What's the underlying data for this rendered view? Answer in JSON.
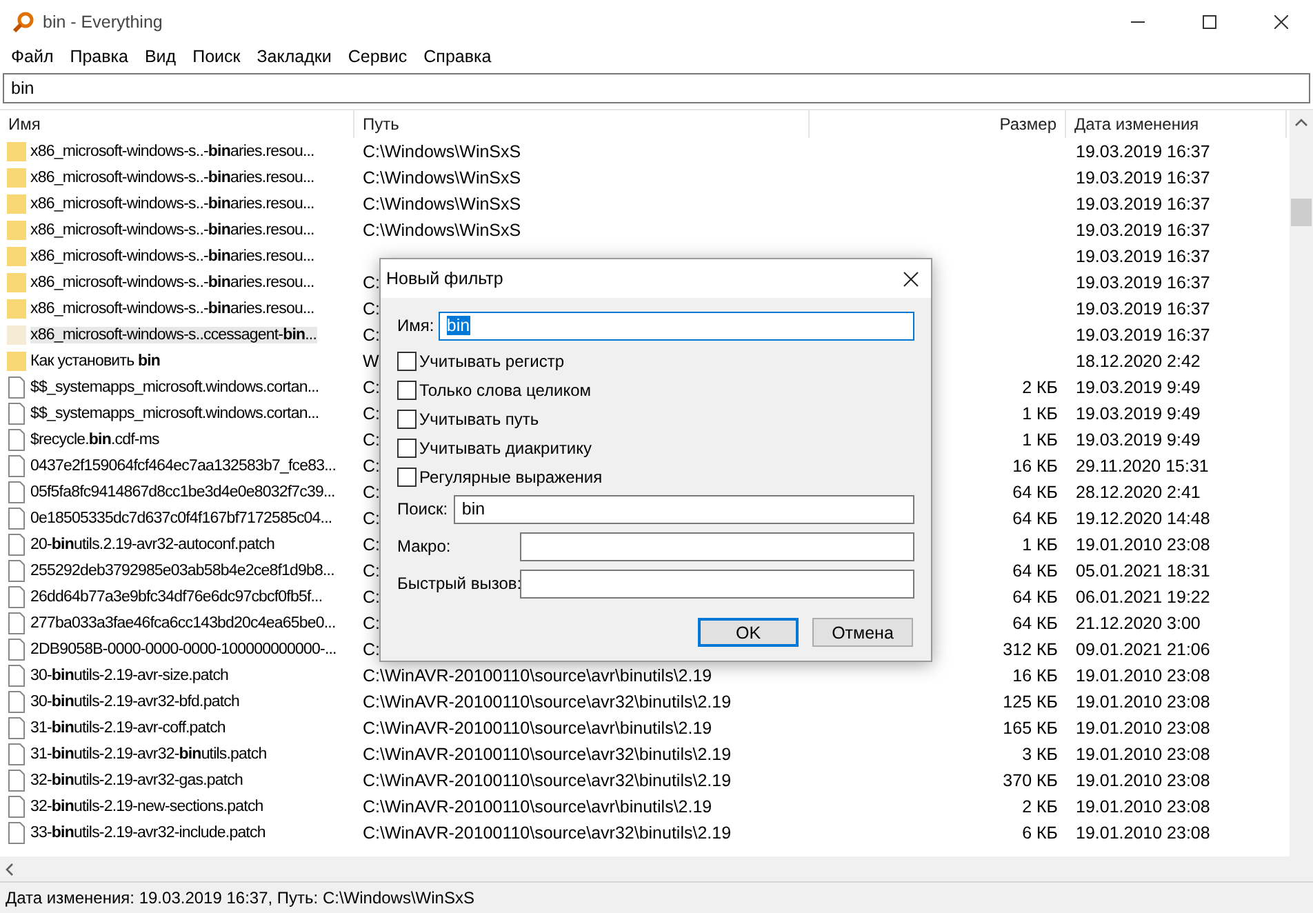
{
  "window": {
    "title": "bin - Everything"
  },
  "menu": [
    {
      "label": "Файл"
    },
    {
      "label": "Правка"
    },
    {
      "label": "Вид"
    },
    {
      "label": "Поиск"
    },
    {
      "label": "Закладки"
    },
    {
      "label": "Сервис"
    },
    {
      "label": "Справка"
    }
  ],
  "search": {
    "value": "bin"
  },
  "table": {
    "columns": [
      "Имя",
      "Путь",
      "Размер",
      "Дата изменения"
    ],
    "rows": [
      {
        "kind": "folder",
        "name": "x86_microsoft-windows-s..-**bin**aries.resou...",
        "path": "C:\\Windows\\WinSxS",
        "date": "19.03.2019 16:37",
        "selected": false
      },
      {
        "kind": "folder",
        "name": "x86_microsoft-windows-s..-**bin**aries.resou...",
        "path": "C:\\Windows\\WinSxS",
        "date": "19.03.2019 16:37",
        "selected": false
      },
      {
        "kind": "folder",
        "name": "x86_microsoft-windows-s..-**bin**aries.resou...",
        "path": "C:\\Windows\\WinSxS",
        "date": "19.03.2019 16:37",
        "selected": false
      },
      {
        "kind": "folder",
        "name": "x86_microsoft-windows-s..-**bin**aries.resou...",
        "path": "C:\\Windows\\WinSxS",
        "date": "19.03.2019 16:37",
        "selected": false
      },
      {
        "kind": "folder",
        "name": "x86_microsoft-windows-s..-**bin**aries.resou...",
        "date": "19.03.2019 16:37",
        "selected": false
      },
      {
        "kind": "folder",
        "name": "x86_microsoft-windows-s..-**bin**aries.resou...",
        "path": "C:",
        "date": "19.03.2019 16:37",
        "selected": false
      },
      {
        "kind": "folder",
        "name": "x86_microsoft-windows-s..-**bin**aries.resou...",
        "path": "C:",
        "date": "19.03.2019 16:37",
        "selected": false
      },
      {
        "kind": "folder",
        "name": "x86_microsoft-windows-s..ccessagent-**bin**...",
        "path": "C:",
        "date": "19.03.2019 16:37",
        "selected": true
      },
      {
        "kind": "folder",
        "name": "Как установить **bin**",
        "path": "W",
        "date": "18.12.2020 2:42",
        "selected": false
      },
      {
        "kind": "file",
        "name": "$$_systemapps_microsoft.windows.cortan...",
        "path": "C:",
        "size": "2 КБ",
        "date": "19.03.2019 9:49",
        "selected": false
      },
      {
        "kind": "file",
        "name": "$$_systemapps_microsoft.windows.cortan...",
        "path": "C:",
        "size": "1 КБ",
        "date": "19.03.2019 9:49",
        "selected": false
      },
      {
        "kind": "file",
        "name": "$recycle.**bin**.cdf-ms",
        "path": "C:",
        "size": "1 КБ",
        "date": "19.03.2019 9:49",
        "selected": false
      },
      {
        "kind": "file",
        "name": "0437e2f159064fcf464ec7aa132583b7_fce83...",
        "path": "C:",
        "size": "16 КБ",
        "date": "29.11.2020 15:31",
        "selected": false
      },
      {
        "kind": "file",
        "name": "05f5fa8fc9414867d8cc1be3d4e0e8032f7c39...",
        "path": "C:",
        "size": "64 КБ",
        "date": "28.12.2020 2:41",
        "selected": false
      },
      {
        "kind": "file",
        "name": "0e18505335dc7d637c0f4f167bf7172585c04...",
        "path": "C:",
        "size": "64 КБ",
        "date": "19.12.2020 14:48",
        "selected": false
      },
      {
        "kind": "file",
        "name": "20-**bin**utils.2.19-avr32-autoconf.patch",
        "path": "C:",
        "size": "1 КБ",
        "date": "19.01.2010 23:08",
        "selected": false
      },
      {
        "kind": "file",
        "name": "255292deb3792985e03ab58b4e2ce8f1d9b8...",
        "path": "C:",
        "size": "64 КБ",
        "date": "05.01.2021 18:31",
        "selected": false
      },
      {
        "kind": "file",
        "name": "26dd64b77a3e9bfc34df76e6dc97cbcf0fb5f...",
        "path": "C:",
        "size": "64 КБ",
        "date": "06.01.2021 19:22",
        "selected": false
      },
      {
        "kind": "file",
        "name": "277ba033a3fae46fca6cc143bd20c4ea65be0...",
        "path": "C:",
        "size": "64 КБ",
        "date": "21.12.2020 3:00",
        "selected": false
      },
      {
        "kind": "file",
        "name": "2DB9058B-0000-0000-0000-100000000000-...",
        "path": "C:",
        "size": "312 КБ",
        "date": "09.01.2021 21:06",
        "selected": false
      },
      {
        "kind": "file",
        "name": "30-**bin**utils-2.19-avr-size.patch",
        "path": "C:\\WinAVR-20100110\\source\\avr\\binutils\\2.19",
        "size": "16 КБ",
        "date": "19.01.2010 23:08",
        "selected": false
      },
      {
        "kind": "file",
        "name": "30-**bin**utils-2.19-avr32-bfd.patch",
        "path": "C:\\WinAVR-20100110\\source\\avr32\\binutils\\2.19",
        "size": "125 КБ",
        "date": "19.01.2010 23:08",
        "selected": false
      },
      {
        "kind": "file",
        "name": "31-**bin**utils-2.19-avr-coff.patch",
        "path": "C:\\WinAVR-20100110\\source\\avr\\binutils\\2.19",
        "size": "165 КБ",
        "date": "19.01.2010 23:08",
        "selected": false
      },
      {
        "kind": "file",
        "name": "31-**bin**utils-2.19-avr32-**bin**utils.patch",
        "path": "C:\\WinAVR-20100110\\source\\avr32\\binutils\\2.19",
        "size": "3 КБ",
        "date": "19.01.2010 23:08",
        "selected": false
      },
      {
        "kind": "file",
        "name": "32-**bin**utils-2.19-avr32-gas.patch",
        "path": "C:\\WinAVR-20100110\\source\\avr32\\binutils\\2.19",
        "size": "370 КБ",
        "date": "19.01.2010 23:08",
        "selected": false
      },
      {
        "kind": "file",
        "name": "32-**bin**utils-2.19-new-sections.patch",
        "path": "C:\\WinAVR-20100110\\source\\avr\\binutils\\2.19",
        "size": "2 КБ",
        "date": "19.01.2010 23:08",
        "selected": false
      },
      {
        "kind": "file",
        "name": "33-**bin**utils-2.19-avr32-include.patch",
        "path": "C:\\WinAVR-20100110\\source\\avr32\\binutils\\2.19",
        "size": "6 КБ",
        "date": "19.01.2010 23:08",
        "selected": false
      }
    ]
  },
  "status_bar": "Дата изменения: 19.03.2019 16:37, Путь: C:\\Windows\\WinSxS",
  "dialog": {
    "title": "Новый фильтр",
    "name_label": "Имя:",
    "name_value": "bin",
    "options": [
      {
        "label": "Учитывать регистр",
        "checked": false
      },
      {
        "label": "Только слова целиком",
        "checked": false
      },
      {
        "label": "Учитывать путь",
        "checked": false
      },
      {
        "label": "Учитывать диакритику",
        "checked": false
      },
      {
        "label": "Регулярные выражения",
        "checked": false
      }
    ],
    "search_label": "Поиск:",
    "search_value": "bin",
    "macro_label": "Макро:",
    "hotkey_label": "Быстрый вызов:",
    "buttons": [
      {
        "label": "OK",
        "default": true
      },
      {
        "label": "Отмена",
        "default": false
      }
    ]
  }
}
